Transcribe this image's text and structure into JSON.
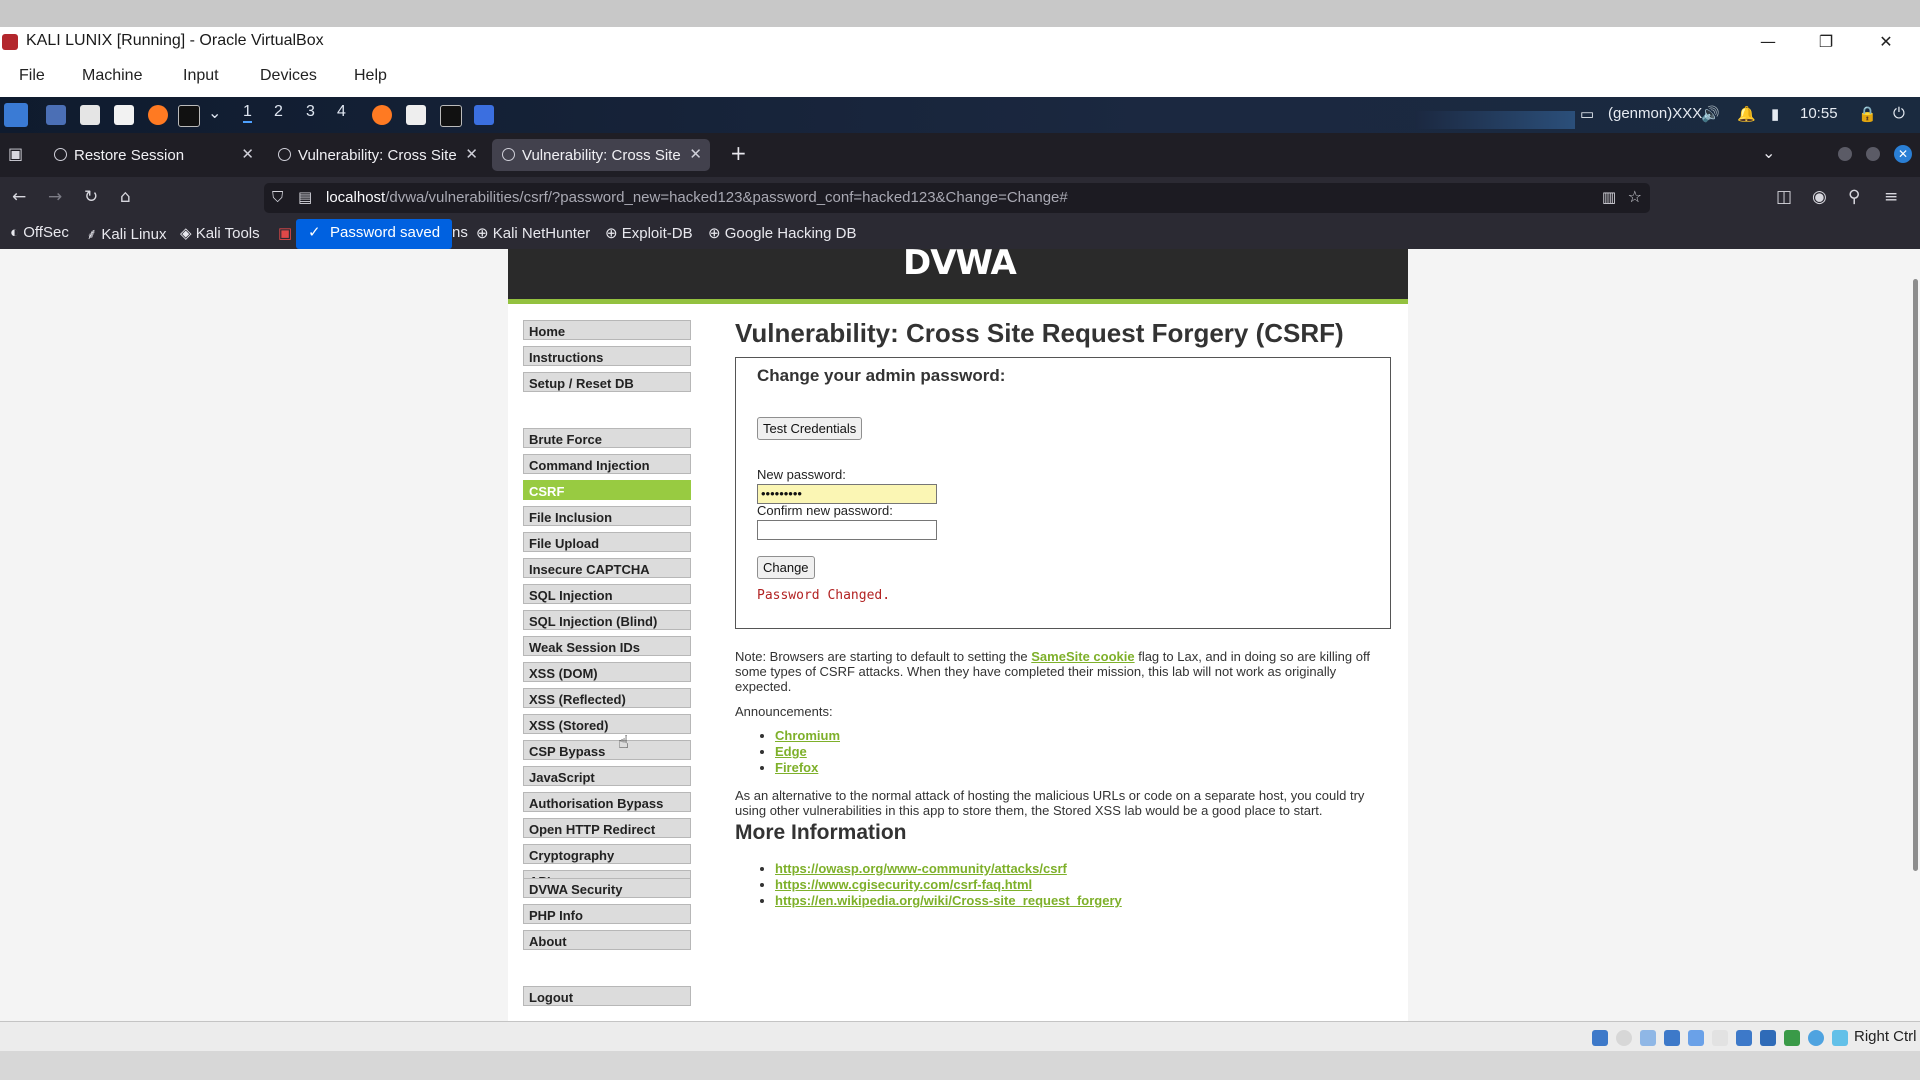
{
  "vbox": {
    "title": "KALI LUNIX [Running] - Oracle VirtualBox",
    "menu": [
      "File",
      "Machine",
      "Input",
      "Devices",
      "Help"
    ],
    "host_key": "Right Ctrl",
    "controls": {
      "minimize": "—",
      "restore": "❐",
      "close": "✕"
    }
  },
  "kali_panel": {
    "workspaces": [
      "1",
      "2",
      "3",
      "4"
    ],
    "user_label": "(genmon)XXX",
    "clock": "10:55"
  },
  "firefox": {
    "tabs": [
      {
        "label": "Restore Session",
        "active": false
      },
      {
        "label": "Vulnerability: Cross Site R",
        "active": false
      },
      {
        "label": "Vulnerability: Cross Site R",
        "active": true
      }
    ],
    "new_tab": "+",
    "url_host": "localhost",
    "url_path": "/dvwa/vulnerabilities/csrf/?password_new=hacked123&password_conf=hacked123&Change=Change#",
    "bookmarks": [
      "OffSec",
      "Kali Linux",
      "Kali Tools",
      "ns",
      "Kali NetHunter",
      "Exploit-DB",
      "Google Hacking DB"
    ],
    "toast": "Password saved"
  },
  "dvwa": {
    "logo": "DVWA",
    "menu_group1": [
      "Home",
      "Instructions",
      "Setup / Reset DB"
    ],
    "menu_group2": [
      "Brute Force",
      "Command Injection",
      "CSRF",
      "File Inclusion",
      "File Upload",
      "Insecure CAPTCHA",
      "SQL Injection",
      "SQL Injection (Blind)",
      "Weak Session IDs",
      "XSS (DOM)",
      "XSS (Reflected)",
      "XSS (Stored)",
      "CSP Bypass",
      "JavaScript",
      "Authorisation Bypass",
      "Open HTTP Redirect",
      "Cryptography",
      "API"
    ],
    "menu_group3": [
      "DVWA Security",
      "PHP Info",
      "About"
    ],
    "menu_group4": [
      "Logout"
    ],
    "active_item": "CSRF",
    "page_title": "Vulnerability: Cross Site Request Forgery (CSRF)",
    "form": {
      "heading": "Change your admin password:",
      "test_button": "Test Credentials",
      "new_label": "New password:",
      "new_value": "•••••••••",
      "confirm_label": "Confirm new password:",
      "confirm_value": "",
      "change_button": "Change",
      "result": "Password Changed."
    },
    "note_prefix": "Note: Browsers are starting to default to setting the ",
    "note_link": "SameSite cookie",
    "note_suffix": " flag to Lax, and in doing so are killing off some types of CSRF attacks. When they have completed their mission, this lab will not work as originally expected.",
    "announcements_label": "Announcements:",
    "announcements": [
      "Chromium",
      "Edge",
      "Firefox"
    ],
    "alternative": "As an alternative to the normal attack of hosting the malicious URLs or code on a separate host, you could try using other vulnerabilities in this app to store them, the Stored XSS lab would be a good place to start.",
    "more_info_title": "More Information",
    "more_info_links": [
      "https://owasp.org/www-community/attacks/csrf",
      "https://www.cgisecurity.com/csrf-faq.html",
      "https://en.wikipedia.org/wiki/Cross-site_request_forgery"
    ]
  },
  "colors": {
    "accent": "#98cb41",
    "link": "#7eb02a",
    "firefox_bg": "#2b2a33",
    "toast": "#0061e0"
  }
}
